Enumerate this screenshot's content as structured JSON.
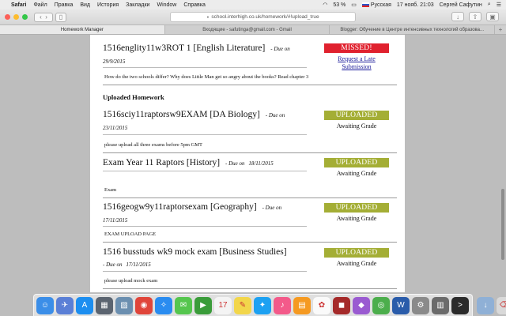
{
  "menubar": {
    "app": "Safari",
    "items": [
      "Файл",
      "Правка",
      "Вид",
      "История",
      "Закладки",
      "Window",
      "Справка"
    ],
    "battery": "53 %",
    "input_source": "Русская",
    "datetime": "17 нояб. 21:03",
    "user": "Сергей Сафутин"
  },
  "browser": {
    "url": "school.interhigh.co.uk/homework/#!upload_true",
    "tabs": [
      {
        "title": "Homework Manager",
        "active": true
      },
      {
        "title": "Входящие - safutinga@gmail.com - Gmail",
        "active": false
      },
      {
        "title": "Blogger: Обучение в Центре интенсивных технологий образова...",
        "active": false
      }
    ]
  },
  "homework": {
    "missed": [
      {
        "title": "1516englity11w3ROT 1 [English Literature]",
        "due_prefix": "- Due on",
        "due_date": "29/9/2015",
        "description": "How do the two schools differ? Why does Little Man get so angry about the books? Read chapter 3",
        "status_label": "MISSED!",
        "action_label": "Request a Late Submission"
      }
    ],
    "uploaded_heading": "Uploaded Homework",
    "uploaded": [
      {
        "title": "1516sciy11raptorsw9EXAM [DA Biology]",
        "due_prefix": "- Due on",
        "due_date": "23/11/2015",
        "description": "please upload all three exams before 5pm GMT",
        "status_label": "UPLOADED",
        "status_sub": "Awaiting Grade"
      },
      {
        "title": "Exam Year 11 Raptors [History]",
        "due_prefix": "- Due on",
        "due_date": "18/11/2015",
        "description": "Exam",
        "status_label": "UPLOADED",
        "status_sub": "Awaiting Grade"
      },
      {
        "title": "1516geogw9y11raptorsexam [Geography]",
        "due_prefix": "- Due on",
        "due_date": "17/11/2015",
        "description": "EXAM UPLOAD PAGE",
        "status_label": "UPLOADED",
        "status_sub": "Awaiting Grade"
      },
      {
        "title": "1516 busstuds wk9 mock exam [Business Studies]",
        "due_prefix": "- Due on",
        "due_date": "17/11/2015",
        "description": "please upload mock exam",
        "status_label": "UPLOADED",
        "status_sub": "Awaiting Grade"
      }
    ]
  },
  "dock": {
    "apps": [
      {
        "name": "finder-icon",
        "color": "#3b8ee8",
        "glyph": "☺"
      },
      {
        "name": "launchpad-icon",
        "color": "#5a7fd6",
        "glyph": "✈"
      },
      {
        "name": "app-store-icon",
        "color": "#1c8ef0",
        "glyph": "A"
      },
      {
        "name": "mission-control-icon",
        "color": "#5b6470",
        "glyph": "▦"
      },
      {
        "name": "preview-icon",
        "color": "#6b8fb0",
        "glyph": "▨"
      },
      {
        "name": "chrome-icon",
        "color": "#e0453a",
        "glyph": "◉"
      },
      {
        "name": "safari-icon",
        "color": "#2a8cf0",
        "glyph": "✧"
      },
      {
        "name": "messages-icon",
        "color": "#55c64e",
        "glyph": "✉"
      },
      {
        "name": "facetime-icon",
        "color": "#3a9c3a",
        "glyph": "▶"
      },
      {
        "name": "calendar-icon",
        "color": "#f4f4f4",
        "glyph": "17"
      },
      {
        "name": "notes-icon",
        "color": "#f2d64b",
        "glyph": "✎"
      },
      {
        "name": "twitter-icon",
        "color": "#1da1f2",
        "glyph": "✦"
      },
      {
        "name": "music-icon",
        "color": "#f35a8a",
        "glyph": "♪"
      },
      {
        "name": "ibooks-icon",
        "color": "#f59a22",
        "glyph": "▤"
      },
      {
        "name": "photos-icon",
        "color": "#fafafa",
        "glyph": "✿"
      },
      {
        "name": "photo-booth-icon",
        "color": "#a52a2a",
        "glyph": "◼"
      },
      {
        "name": "game-center-icon",
        "color": "#9a5bd1",
        "glyph": "◆"
      },
      {
        "name": "podcast-icon",
        "color": "#4cae4c",
        "glyph": "◎"
      },
      {
        "name": "word-icon",
        "color": "#2a5caa",
        "glyph": "W"
      },
      {
        "name": "system-preferences-icon",
        "color": "#8a8a8a",
        "glyph": "⚙"
      },
      {
        "name": "calculator-icon",
        "color": "#6b6b6b",
        "glyph": "▥"
      },
      {
        "name": "terminal-icon",
        "color": "#2b2b2b",
        "glyph": ">"
      }
    ],
    "trailing": [
      {
        "name": "downloads-folder-icon",
        "color": "#8fb0d6",
        "glyph": "↓"
      },
      {
        "name": "trash-icon",
        "color": "#d9d9d9",
        "glyph": "⌫"
      }
    ]
  }
}
